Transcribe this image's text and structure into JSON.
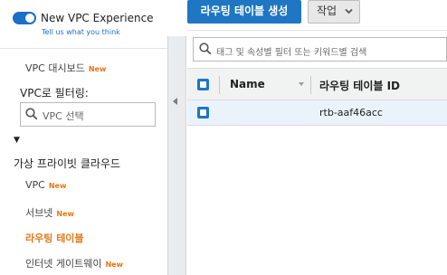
{
  "sidebar": {
    "new_experience": {
      "title": "New VPC Experience",
      "link": "Tell us what you think",
      "enabled": true
    },
    "dashboard": {
      "label": "VPC 대시보드",
      "badge": "New"
    },
    "filter": {
      "label": "VPC로 필터링:",
      "placeholder": "VPC 선택"
    },
    "section": {
      "title": "가상 프라이빗 클라우드"
    },
    "items": [
      {
        "label": "VPC",
        "badge": "New",
        "active": false
      },
      {
        "label": "서브넷",
        "badge": "New",
        "active": false
      },
      {
        "label": "라우팅 테이블",
        "badge": "",
        "active": true
      },
      {
        "label": "인터넷 게이트웨이",
        "badge": "New",
        "active": false
      }
    ]
  },
  "toolbar": {
    "create_label": "라우팅 테이블 생성",
    "actions_label": "작업"
  },
  "search": {
    "placeholder": "태그 및 속성별 필터 또는 키워드별 검색"
  },
  "table": {
    "columns": [
      "Name",
      "라우팅 테이블 ID"
    ],
    "rows": [
      {
        "name": "",
        "route_table_id": "rtb-aaf46acc",
        "selected": true
      }
    ]
  },
  "colors": {
    "accent": "#1f76c2",
    "badge": "#ec7211",
    "active_nav": "#e07b1d",
    "selected_row": "#eaf3fb"
  }
}
